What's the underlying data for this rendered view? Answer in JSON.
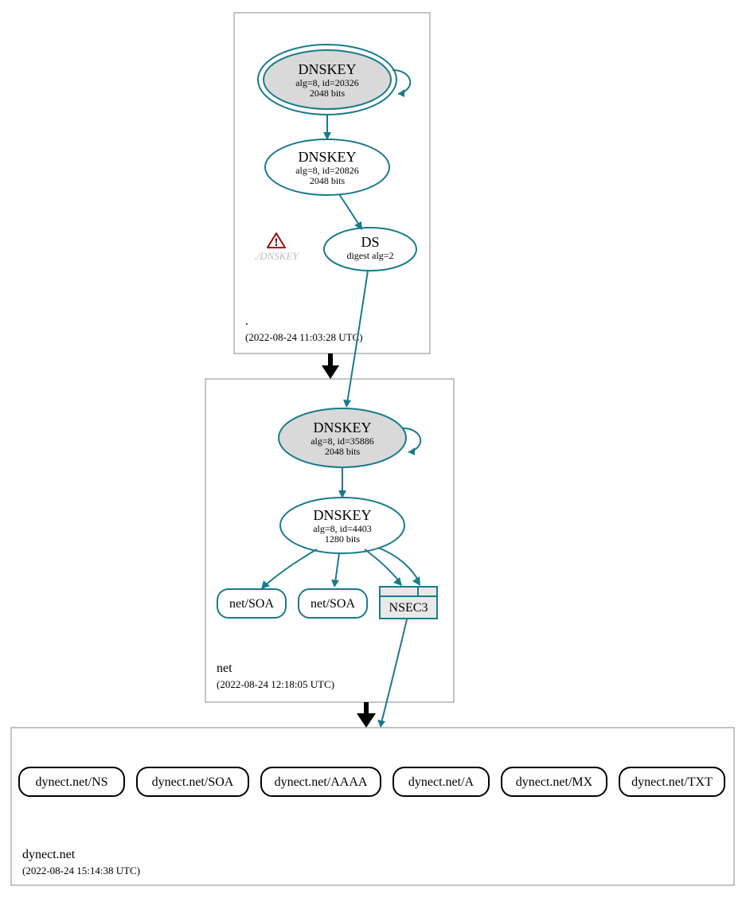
{
  "zones": {
    "root": {
      "name": ".",
      "time": "(2022-08-24 11:03:28 UTC)",
      "ksk": {
        "title": "DNSKEY",
        "line2": "alg=8, id=20326",
        "line3": "2048 bits"
      },
      "zsk": {
        "title": "DNSKEY",
        "line2": "alg=8, id=20826",
        "line3": "2048 bits"
      },
      "ds": {
        "title": "DS",
        "line2": "digest alg=2"
      },
      "warn_label": "./DNSKEY"
    },
    "net": {
      "name": "net",
      "time": "(2022-08-24 12:18:05 UTC)",
      "ksk": {
        "title": "DNSKEY",
        "line2": "alg=8, id=35886",
        "line3": "2048 bits"
      },
      "zsk": {
        "title": "DNSKEY",
        "line2": "alg=8, id=4403",
        "line3": "1280 bits"
      },
      "soa1": "net/SOA",
      "soa2": "net/SOA",
      "nsec": "NSEC3"
    },
    "dynect": {
      "name": "dynect.net",
      "time": "(2022-08-24 15:14:38 UTC)",
      "rr": {
        "ns": "dynect.net/NS",
        "soa": "dynect.net/SOA",
        "aaaa": "dynect.net/AAAA",
        "a": "dynect.net/A",
        "mx": "dynect.net/MX",
        "txt": "dynect.net/TXT"
      }
    }
  }
}
